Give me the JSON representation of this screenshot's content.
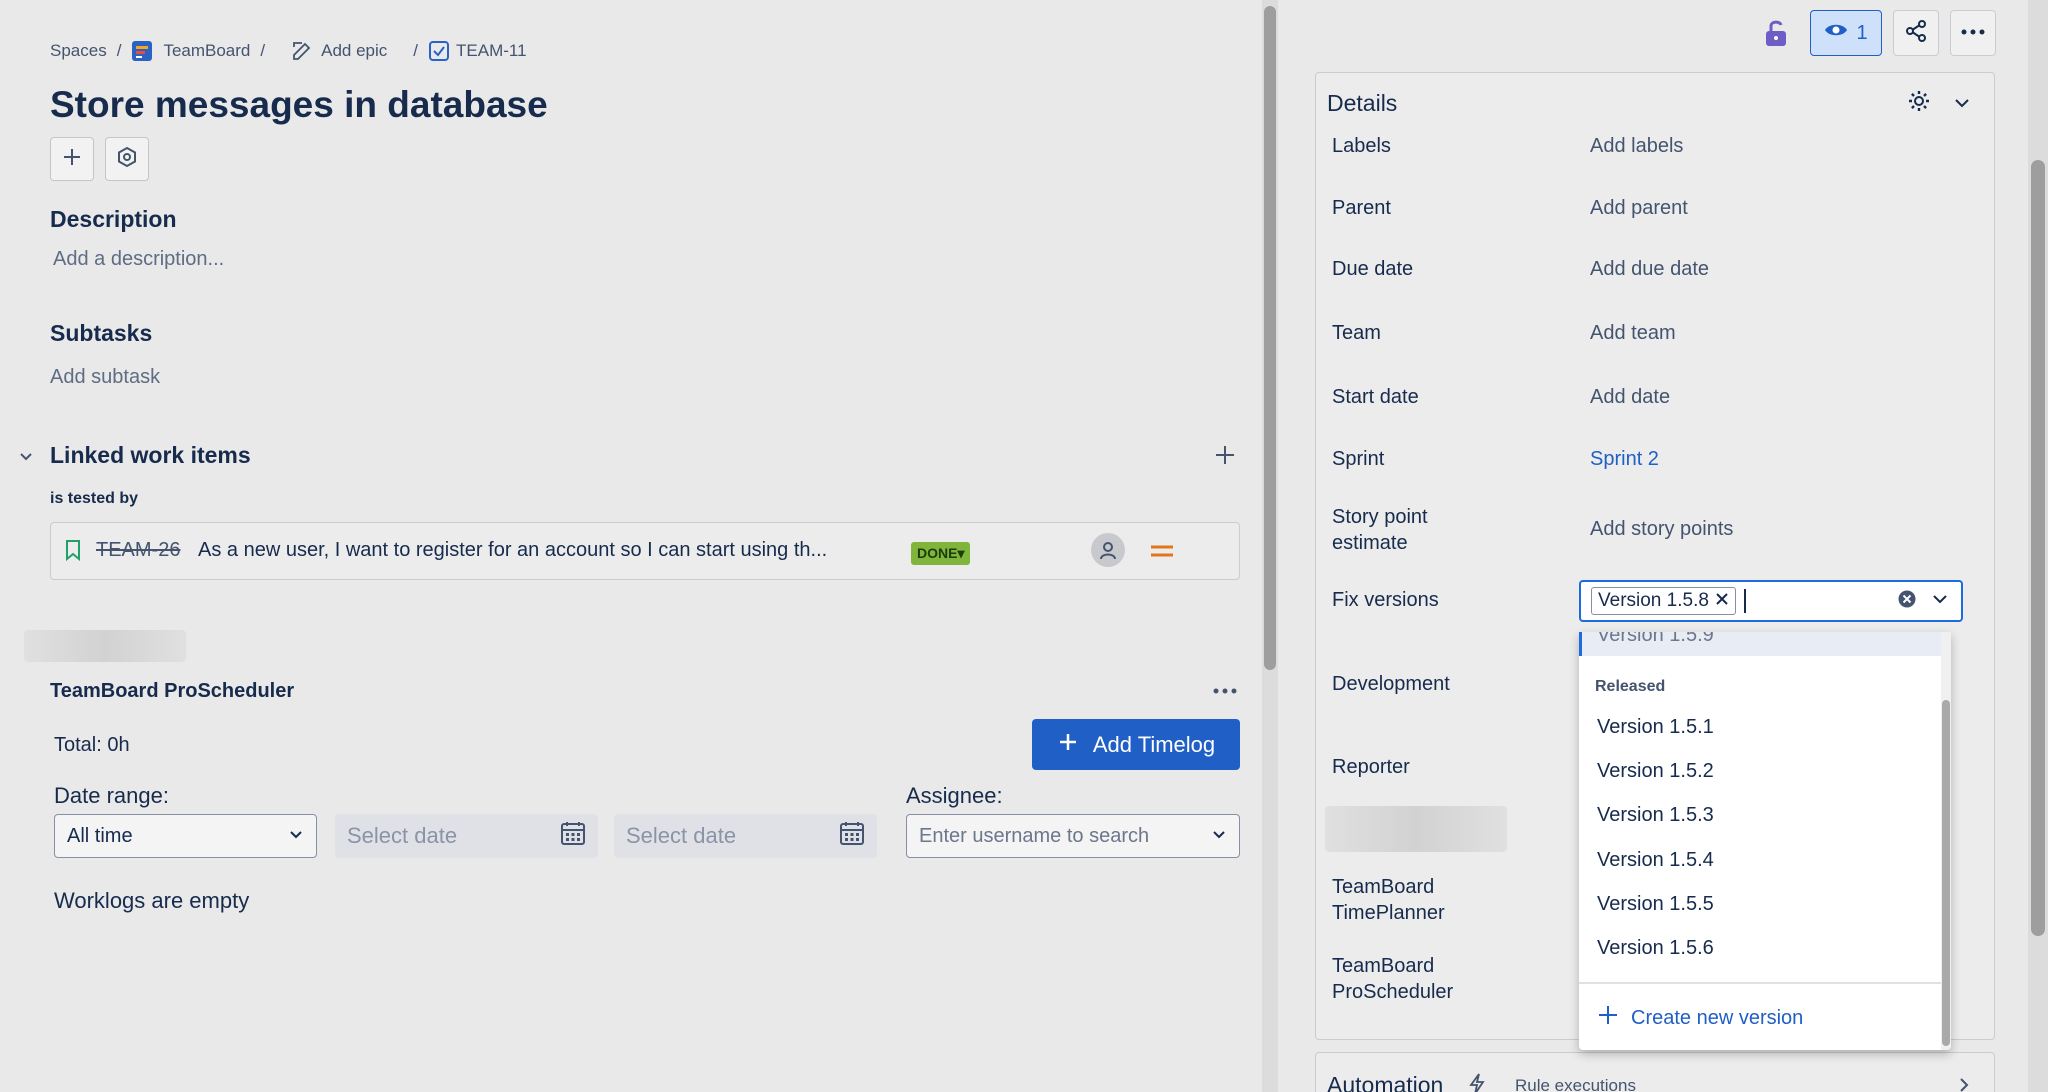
{
  "breadcrumb": {
    "spaces": "Spaces",
    "project": "TeamBoard",
    "add_epic": "Add epic",
    "issue_key": "TEAM-11"
  },
  "issue": {
    "title": "Store messages in database"
  },
  "description": {
    "heading": "Description",
    "placeholder": "Add a description..."
  },
  "subtasks": {
    "heading": "Subtasks",
    "add_label": "Add subtask"
  },
  "linked": {
    "heading": "Linked work items",
    "relation": "is tested by",
    "items": [
      {
        "key": "TEAM-26",
        "summary": "As a new user, I want to register for an account so I can start using th...",
        "status": "DONE"
      }
    ]
  },
  "scheduler": {
    "title": "TeamBoard ProScheduler",
    "total": "Total: 0h",
    "add_timelog": "Add Timelog",
    "date_range_label": "Date range:",
    "date_range_value": "All time",
    "select_date_placeholder": "Select date",
    "assignee_label": "Assignee:",
    "assignee_placeholder": "Enter username to search",
    "empty_text": "Worklogs are empty"
  },
  "header": {
    "watch_count": "1"
  },
  "details": {
    "heading": "Details",
    "fields": [
      {
        "label": "Labels",
        "value": "Add labels"
      },
      {
        "label": "Parent",
        "value": "Add parent"
      },
      {
        "label": "Due date",
        "value": "Add due date"
      },
      {
        "label": "Team",
        "value": "Add team"
      },
      {
        "label": "Start date",
        "value": "Add date"
      },
      {
        "label": "Sprint",
        "value": "Sprint 2"
      },
      {
        "label": "Story point\nestimate",
        "value": "Add story points"
      }
    ],
    "fix_versions_label": "Fix versions",
    "selected_version": "Version 1.5.8",
    "development_label": "Development",
    "reporter_label": "Reporter",
    "timeplanner_label": "TeamBoard TimePlanner",
    "proscheduler_label": "TeamBoard ProScheduler"
  },
  "version_dropdown": {
    "partial_item": "Version 1.5.9",
    "group_label": "Released",
    "items": [
      "Version 1.5.1",
      "Version 1.5.2",
      "Version 1.5.3",
      "Version 1.5.4",
      "Version 1.5.5",
      "Version 1.5.6"
    ],
    "create_label": "Create new version"
  },
  "automation": {
    "heading": "Automation",
    "rule_executions": "Rule executions"
  }
}
